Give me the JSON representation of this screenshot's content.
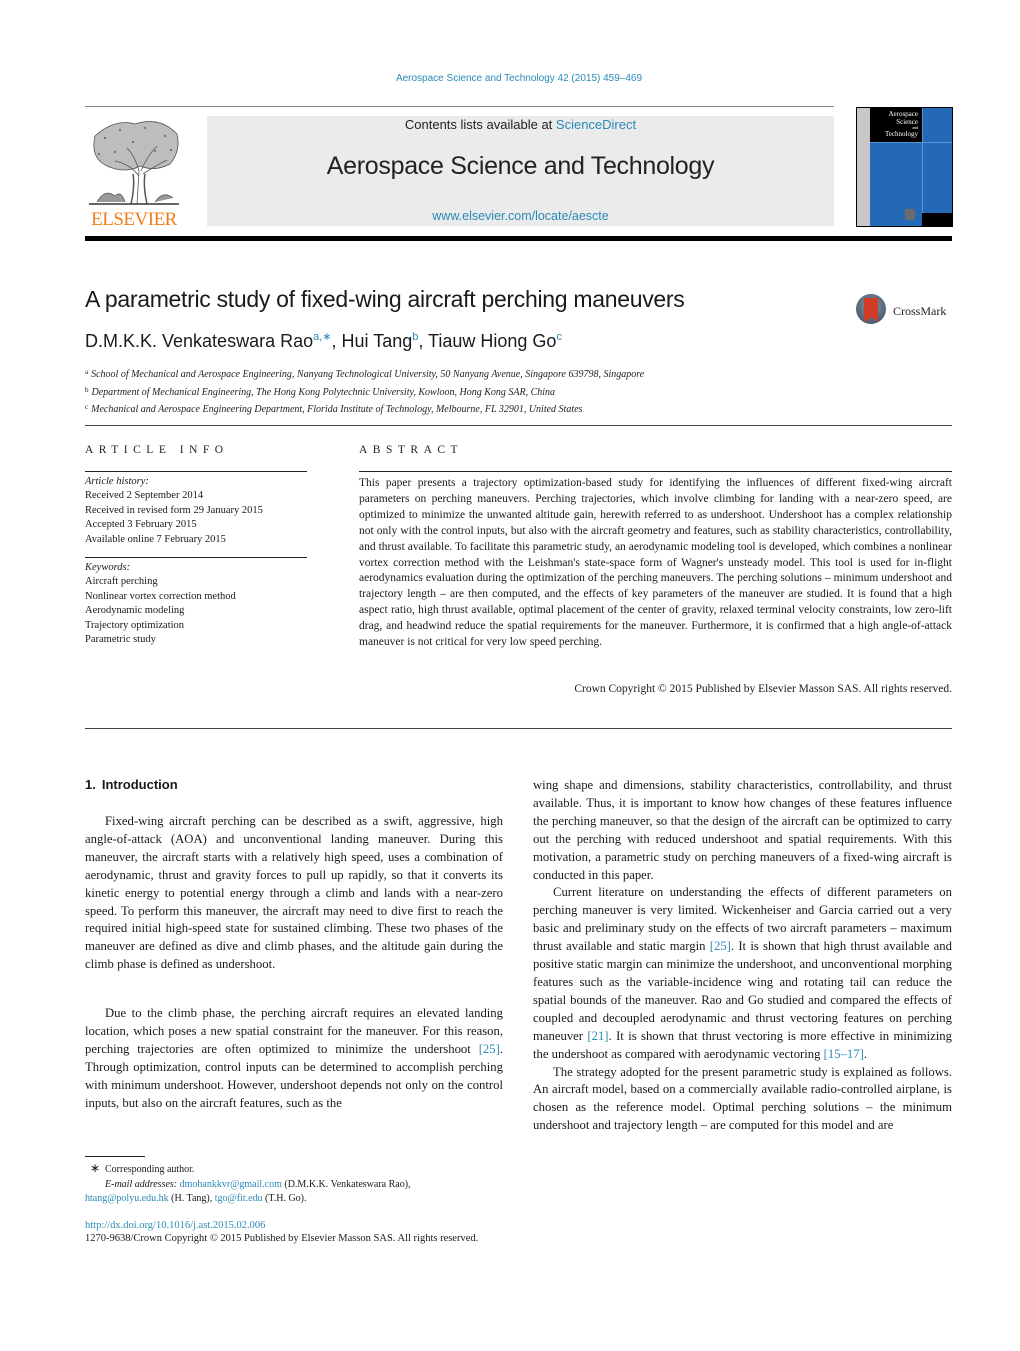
{
  "journal_reference": "Aerospace Science and Technology 42 (2015) 459–469",
  "header": {
    "publisher_logo_text": "ELSEVIER",
    "contents_prefix": "Contents lists available at ",
    "contents_link": "ScienceDirect",
    "journal_title": "Aerospace Science and Technology",
    "journal_url": "www.elsevier.com/locate/aescte",
    "cover": {
      "line1": "Aerospace",
      "line2": "Science",
      "line3": "and",
      "line4": "Technology"
    }
  },
  "colors": {
    "link": "#2a8ab8",
    "elsevier_orange": "#f07d17",
    "cover_blue": "#2369b5",
    "header_box": "#ebebeb"
  },
  "article": {
    "title": "A parametric study of fixed-wing aircraft perching maneuvers",
    "crossmark_label": "CrossMark",
    "authors": [
      {
        "name": "D.M.K.K. Venkateswara Rao",
        "sup": "a,∗"
      },
      {
        "name": "Hui Tang",
        "sup": "b"
      },
      {
        "name": "Tiauw Hiong Go",
        "sup": "c"
      }
    ],
    "affiliations": [
      {
        "key": "a",
        "text": "School of Mechanical and Aerospace Engineering, Nanyang Technological University, 50 Nanyang Avenue, Singapore 639798, Singapore"
      },
      {
        "key": "b",
        "text": "Department of Mechanical Engineering, The Hong Kong Polytechnic University, Kowloon, Hong Kong SAR, China"
      },
      {
        "key": "c",
        "text": "Mechanical and Aerospace Engineering Department, Florida Institute of Technology, Melbourne, FL 32901, United States"
      }
    ]
  },
  "article_info": {
    "heading": "ARTICLE INFO",
    "history_label": "Article history:",
    "history": [
      "Received 2 September 2014",
      "Received in revised form 29 January 2015",
      "Accepted 3 February 2015",
      "Available online 7 February 2015"
    ],
    "keywords_label": "Keywords:",
    "keywords": [
      "Aircraft perching",
      "Nonlinear vortex correction method",
      "Aerodynamic modeling",
      "Trajectory optimization",
      "Parametric study"
    ]
  },
  "abstract": {
    "heading": "ABSTRACT",
    "text": "This paper presents a trajectory optimization-based study for identifying the influences of different fixed-wing aircraft parameters on perching maneuvers. Perching trajectories, which involve climbing for landing with a near-zero speed, are optimized to minimize the unwanted altitude gain, herewith referred to as undershoot. Undershoot has a complex relationship not only with the control inputs, but also with the aircraft geometry and features, such as stability characteristics, controllability, and thrust available. To facilitate this parametric study, an aerodynamic modeling tool is developed, which combines a nonlinear vortex correction method with the Leishman's state-space form of Wagner's unsteady model. This tool is used for in-flight aerodynamics evaluation during the optimization of the perching maneuvers. The perching solutions – minimum undershoot and trajectory length – are then computed, and the effects of key parameters of the maneuver are studied. It is found that a high aspect ratio, high thrust available, optimal placement of the center of gravity, relaxed terminal velocity constraints, low zero-lift drag, and headwind reduce the spatial requirements for the maneuver. Furthermore, it is confirmed that a high angle-of-attack maneuver is not critical for very low speed perching.",
    "copyright": "Crown Copyright © 2015 Published by Elsevier Masson SAS. All rights reserved."
  },
  "body": {
    "section_number": "1.",
    "section_title": "Introduction",
    "left_paragraphs": [
      {
        "text": "Fixed-wing aircraft perching can be described as a swift, aggres­sive, high angle-of-attack (AOA) and unconventional landing ma­neuver. During this maneuver, the aircraft starts with a relatively high speed, uses a combination of aerodynamic, thrust and grav­ity forces to pull up rapidly, so that it converts its kinetic energy to potential energy through a climb and lands with a near-zero speed. To perform this maneuver, the aircraft may need to dive first to reach the required initial high-speed state for sustained climbing. These two phases of the maneuver are defined as dive and climb phases, and the altitude gain during the climb phase is defined as undershoot."
      },
      {
        "before": "Due to the climb phase, the perching aircraft requires an ele­vated landing location, which poses a new spatial constraint for the maneuver. For this reason, perching trajectories are often op­timized to minimize the undershoot ",
        "ref": "[25]",
        "after": ". Through optimization, control inputs can be determined to accomplish perching with minimum undershoot. However, undershoot depends not only on the control inputs, but also on the aircraft features, such as the"
      }
    ],
    "right_paragraphs": [
      {
        "text": "wing shape and dimensions, stability characteristics, controllability, and thrust available. Thus, it is important to know how changes of these features influence the perching maneuver, so that the design of the aircraft can be optimized to carry out the perching with re­duced undershoot and spatial requirements. With this motivation, a parametric study on perching maneuvers of a fixed-wing aircraft is conducted in this paper."
      },
      {
        "s1": "Current literature on understanding the effects of different pa­rameters on perching maneuver is very limited. Wickenheiser and Garcia carried out a very basic and preliminary study on the effects of two aircraft parameters – maximum thrust available and static margin ",
        "ref1": "[25]",
        "s2": ". It is shown that high thrust available and positive static margin can minimize the undershoot, and unconventional morphing features such as the variable-incidence wing and rotat­ing tail can reduce the spatial bounds of the maneuver. Rao and Go studied and compared the effects of coupled and decoupled aero­dynamic and thrust vectoring features on perching maneuver ",
        "ref2": "[21]",
        "s3": ". It is shown that thrust vectoring is more effective in minimizing the undershoot as compared with aerodynamic vectoring ",
        "ref3": "[15–17]",
        "s4": "."
      },
      {
        "text": "The strategy adopted for the present parametric study is ex­plained as follows. An aircraft model, based on a commercially available radio-controlled airplane, is chosen as the reference model. Optimal perching solutions – the minimum undershoot and trajectory length – are computed for this model and are"
      }
    ]
  },
  "footnotes": {
    "star": "∗",
    "corresponding": "Corresponding author.",
    "email_label": "E-mail addresses:",
    "emails": [
      {
        "address": "dmohankkvr@gmail.com",
        "owner": " (D.M.K.K. Venkateswara Rao),",
        "sep": ""
      },
      {
        "address": "htang@polyu.edu.hk",
        "owner": " (H. Tang), ",
        "sep": ""
      },
      {
        "address": "tgo@fit.edu",
        "owner": " (T.H. Go).",
        "sep": ""
      }
    ],
    "doi": "http://dx.doi.org/10.1016/j.ast.2015.02.006",
    "issn_line": "1270-9638/Crown Copyright © 2015 Published by Elsevier Masson SAS. All rights reserved."
  }
}
